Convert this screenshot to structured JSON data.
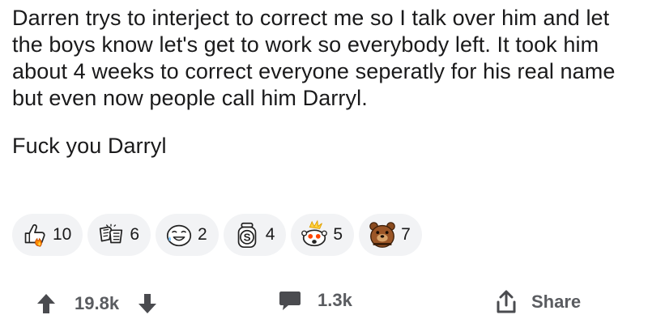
{
  "post": {
    "paragraphs": [
      "Darren trys to interject to correct me so I talk over him and let the boys know let's get to work so everybody left. It took him about 4 weeks to correct everyone seperatly for his real name but even now people call him Darryl.",
      "Fuck you Darryl"
    ]
  },
  "awards": [
    {
      "icon": "thumbs-up-fire-award-icon",
      "count": "10"
    },
    {
      "icon": "fist-bump-award-icon",
      "count": "6"
    },
    {
      "icon": "laughing-face-award-icon",
      "count": "2"
    },
    {
      "icon": "coin-jar-award-icon",
      "count": "4"
    },
    {
      "icon": "snoo-mindblown-award-icon",
      "count": "5"
    },
    {
      "icon": "bear-award-icon",
      "count": "7"
    }
  ],
  "actions": {
    "score": "19.8k",
    "comments": "1.3k",
    "share_label": "Share"
  },
  "colors": {
    "text": "#1a1a1b",
    "meta": "#5a5c60",
    "pill": "#f2f3f5"
  }
}
